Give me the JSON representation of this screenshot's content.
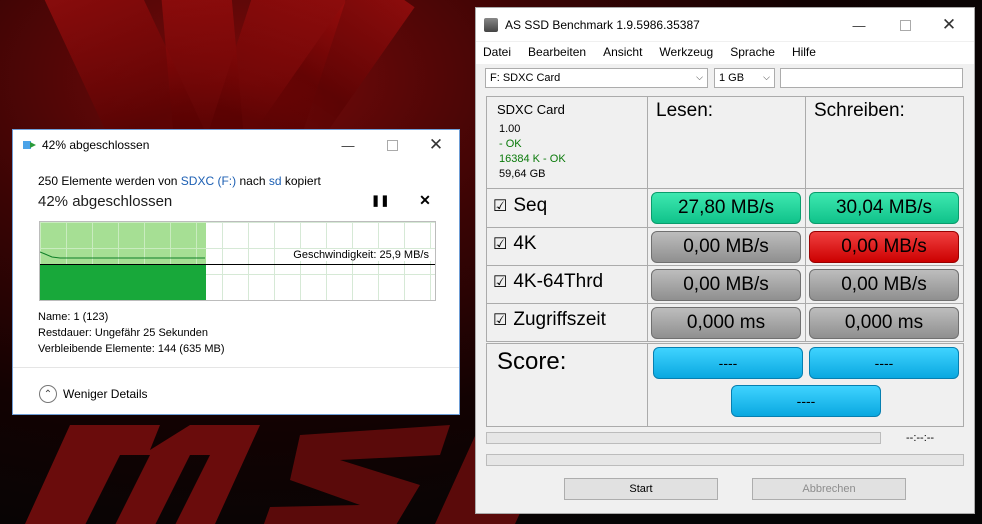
{
  "copy_dialog": {
    "title": "42% abgeschlossen",
    "line_prefix": "250 Elemente werden von",
    "source": "SDXC (F:)",
    "mid": "nach",
    "dest": "sd",
    "suffix": "kopiert",
    "percent_text": "42% abgeschlossen",
    "progress_fraction": 0.42,
    "speed_label": "Geschwindigkeit: 25,9 MB/s",
    "name_label": "Name:",
    "name_value": "1 (123)",
    "remaining_time_label": "Restdauer:",
    "remaining_time_value": "Ungefähr 25 Sekunden",
    "remaining_items_label": "Verbleibende Elemente:",
    "remaining_items_value": "144 (635 MB)",
    "details_label": "Weniger Details",
    "accent_color": "#18a83a"
  },
  "asssd": {
    "title": "AS SSD Benchmark 1.9.5986.35387",
    "menu": [
      "Datei",
      "Bearbeiten",
      "Ansicht",
      "Werkzeug",
      "Sprache",
      "Hilfe"
    ],
    "drive_select": "F: SDXC Card",
    "size_select": "1 GB",
    "text_field": "",
    "device": {
      "name": "SDXC Card",
      "version": "1.00",
      "status1": "- OK",
      "status2": "16384 K - OK",
      "capacity": "59,64 GB"
    },
    "read_header": "Lesen:",
    "write_header": "Schreiben:",
    "rows": [
      {
        "label": "Seq",
        "read": "27,80 MB/s",
        "write": "30,04 MB/s",
        "read_color": "green",
        "write_color": "green"
      },
      {
        "label": "4K",
        "read": "0,00 MB/s",
        "write": "0,00 MB/s",
        "read_color": "gray",
        "write_color": "red"
      },
      {
        "label": "4K-64Thrd",
        "read": "0,00 MB/s",
        "write": "0,00 MB/s",
        "read_color": "gray",
        "write_color": "gray"
      },
      {
        "label": "Zugriffszeit",
        "read": "0,000 ms",
        "write": "0,000 ms",
        "read_color": "gray",
        "write_color": "gray"
      }
    ],
    "score_label": "Score:",
    "score_read": "----",
    "score_write": "----",
    "score_total": "----",
    "time_text": "--:--:--",
    "start_button": "Start",
    "cancel_button": "Abbrechen"
  }
}
